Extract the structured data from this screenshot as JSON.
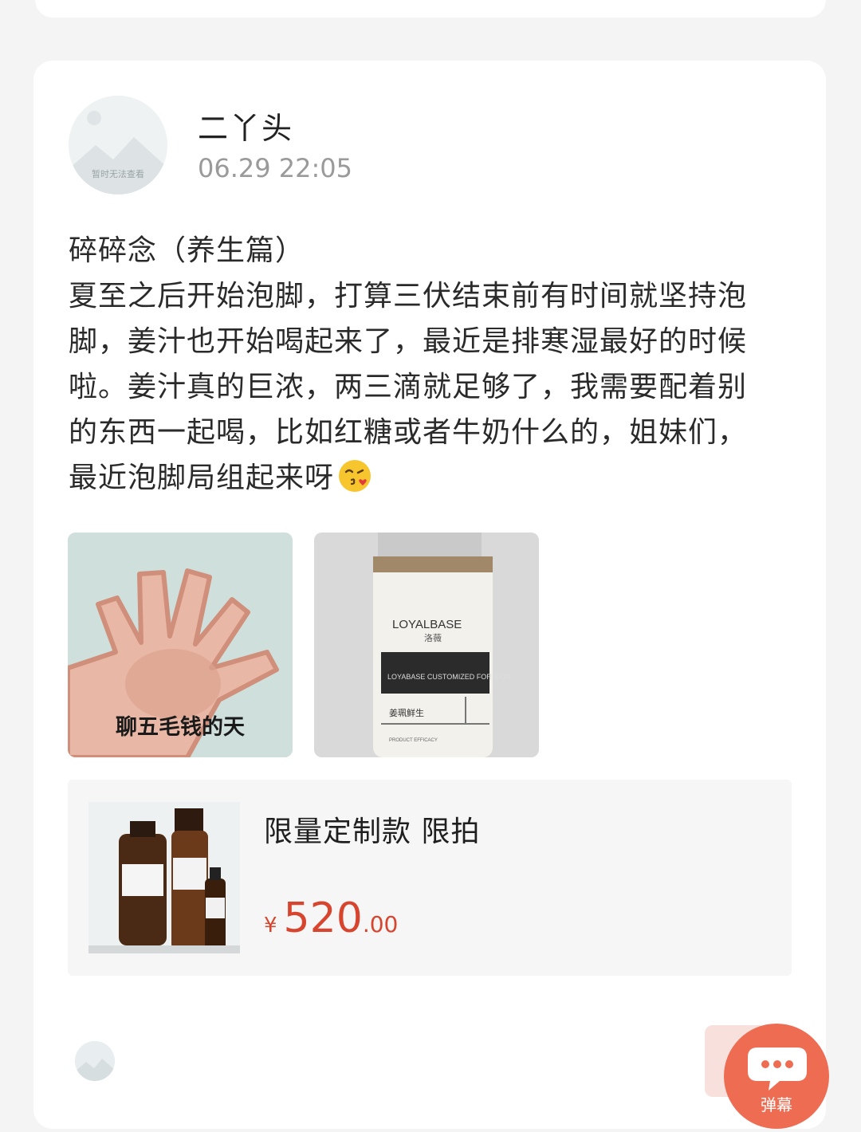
{
  "post": {
    "author": "二丫头",
    "avatar_label": "暂时无法查看",
    "timestamp": "06.29 22:05",
    "text_lines": [
      "碎碎念（养生篇）",
      "夏至之后开始泡脚，打算三伏结束前有时间就坚持泡",
      "脚，姜汁也开始喝起来了，最近是排寒湿最好的时候",
      "啦。姜汁真的巨浓，两三滴就足够了，我需要配着别",
      "的东西一起喝，比如红糖或者牛奶什么的，姐妹们，",
      "最近泡脚局组起来呀"
    ],
    "trailing_emoji": "kiss-emoji",
    "images": [
      {
        "caption": "聊五毛钱的天",
        "kind": "meme"
      },
      {
        "kind": "product-photo",
        "brand": "LOYALBASE",
        "brand_cn": "洛薇",
        "band_text": "LOYABASE CUSTOMIZED FOR SKIN",
        "label_text": "姜珮鲜生",
        "small_text": "PRODUCT EFFICACY"
      }
    ]
  },
  "product": {
    "title": "限量定制款 限拍",
    "currency": "¥",
    "price_int": "520",
    "price_dec": ".00"
  },
  "fab": {
    "label": "弹幕",
    "icon": "chat-bubble-icon"
  },
  "colors": {
    "accent": "#ee6c52",
    "price": "#d8452f",
    "background": "#f4f4f4"
  }
}
